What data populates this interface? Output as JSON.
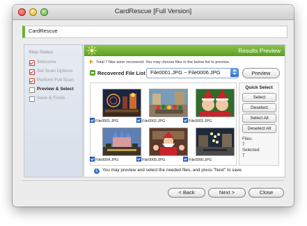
{
  "window": {
    "title": "CardRescue [Full Version]"
  },
  "app_bar": {
    "label": "CardRescue"
  },
  "sidebar": {
    "title": "Step Status",
    "steps": [
      {
        "label": "Welcome",
        "state": "done"
      },
      {
        "label": "Set Scan Options",
        "state": "done"
      },
      {
        "label": "Perform Full Scan",
        "state": "done"
      },
      {
        "label": "Preview & Select",
        "state": "active"
      },
      {
        "label": "Save & Finish",
        "state": "pending"
      }
    ]
  },
  "header": {
    "title": "Results Preview"
  },
  "info_text": "Total 7 files were recovered. You may choose files in the below list to preview.",
  "recovered": {
    "label": "Recovered File List",
    "selected_range": "File0001.JPG ~ File0006.JPG"
  },
  "preview_button": "Preview",
  "thumbnails": [
    {
      "name": "File0001.JPG",
      "checked": true
    },
    {
      "name": "File0002.JPG",
      "checked": true
    },
    {
      "name": "File0003.JPG",
      "checked": true
    },
    {
      "name": "File0004.JPG",
      "checked": true
    },
    {
      "name": "File0005.JPG",
      "checked": true
    },
    {
      "name": "File0006.JPG",
      "checked": true
    }
  ],
  "quick_select": {
    "title": "Quick Select",
    "buttons": [
      "Select",
      "Deselect",
      "Select All",
      "Deselect All"
    ],
    "files_label": "Files:",
    "files_count": "7",
    "selected_label": "Selected:",
    "selected_count": "7"
  },
  "hint": "You may preview and select the needed files, and press \"Next\" to save.",
  "nav": {
    "back": "< Back",
    "next": "Next >",
    "close": "Close"
  },
  "colors": {
    "accent_green": "#6ab42c",
    "header_green": "#5a9e24",
    "select_blue": "#2f6fd1"
  }
}
